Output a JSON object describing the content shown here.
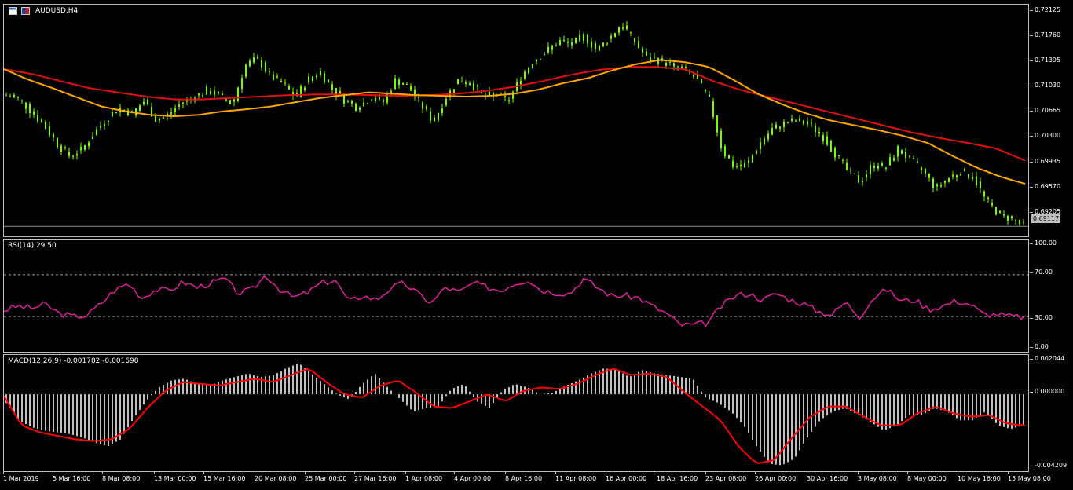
{
  "window": {
    "symbol_title": "AUDUSD,H4"
  },
  "price_axis": [
    "0.72125",
    "0.71760",
    "0.71395",
    "0.71030",
    "0.70665",
    "0.70300",
    "0.69935",
    "0.69570",
    "0.69205"
  ],
  "current_price": "0.69117",
  "rsi": {
    "label": "RSI(14) 29.50",
    "ticks": [
      "100.00",
      "70.00",
      "30.00",
      "0.00"
    ]
  },
  "macd": {
    "label": "MACD(12,26,9) -0.001782 -0.001698",
    "ticks": [
      "0.002044",
      "0.000000",
      "-0.004209"
    ]
  },
  "time_axis": [
    "1 Mar 2019",
    "5 Mar 16:00",
    "8 Mar 08:00",
    "13 Mar 00:00",
    "15 Mar 16:00",
    "20 Mar 08:00",
    "25 Mar 00:00",
    "27 Mar 16:00",
    "1 Apr 08:00",
    "4 Apr 00:00",
    "8 Apr 16:00",
    "11 Apr 08:00",
    "16 Apr 00:00",
    "18 Apr 16:00",
    "23 Apr 08:00",
    "26 Apr 00:00",
    "30 Apr 16:00",
    "3 May 08:00",
    "8 May 00:00",
    "10 May 16:00",
    "15 May 08:00"
  ],
  "colors": {
    "candles": "#7cfc00",
    "ma_fast": "#ffa500",
    "ma_slow": "#e01010",
    "rsi": "#e0209a",
    "macd_hist": "#c0c0c0",
    "macd_signal": "#ff0000"
  },
  "chart_data": [
    {
      "type": "line",
      "title": "AUDUSD,H4",
      "ylim": [
        0.6903,
        0.7222
      ],
      "x_range": [
        "1 Mar 2019",
        "15 May 08:00"
      ],
      "series": [
        {
          "name": "price",
          "style": "candles",
          "values": [
            0.7098,
            0.7092,
            0.7075,
            0.7055,
            0.703,
            0.7012,
            0.702,
            0.7045,
            0.7065,
            0.708,
            0.7072,
            0.709,
            0.706,
            0.7072,
            0.7088,
            0.7095,
            0.7105,
            0.7098,
            0.7085,
            0.714,
            0.715,
            0.7125,
            0.7115,
            0.7095,
            0.712,
            0.7132,
            0.7105,
            0.709,
            0.708,
            0.7095,
            0.7088,
            0.712,
            0.711,
            0.7085,
            0.706,
            0.7095,
            0.712,
            0.7115,
            0.7095,
            0.71,
            0.709,
            0.7125,
            0.7148,
            0.716,
            0.7175,
            0.717,
            0.7182,
            0.7162,
            0.7178,
            0.72,
            0.7175,
            0.715,
            0.7148,
            0.714,
            0.7135,
            0.712,
            0.709,
            0.702,
            0.6995,
            0.7,
            0.703,
            0.705,
            0.7058,
            0.7062,
            0.7055,
            0.704,
            0.7015,
            0.699,
            0.6975,
            0.7,
            0.6995,
            0.7022,
            0.7005,
            0.699,
            0.6965,
            0.698,
            0.699,
            0.6982,
            0.6948,
            0.693,
            0.6922,
            0.6912
          ]
        },
        {
          "name": "ma_fast",
          "values": [
            0.7135,
            0.712,
            0.7108,
            0.7095,
            0.7082,
            0.7075,
            0.707,
            0.7068,
            0.707,
            0.7075,
            0.7078,
            0.7082,
            0.7088,
            0.7094,
            0.7098,
            0.7102,
            0.71,
            0.7098,
            0.7097,
            0.7096,
            0.7097,
            0.71,
            0.7106,
            0.7115,
            0.7122,
            0.7133,
            0.7142,
            0.7148,
            0.7145,
            0.7138,
            0.712,
            0.71,
            0.7085,
            0.7072,
            0.7062,
            0.7055,
            0.7048,
            0.704,
            0.703,
            0.7012,
            0.6995,
            0.6982,
            0.6972
          ]
        },
        {
          "name": "ma_slow",
          "values": [
            0.7135,
            0.7128,
            0.7118,
            0.7108,
            0.7102,
            0.7096,
            0.7092,
            0.7092,
            0.7094,
            0.7096,
            0.7098,
            0.7099,
            0.7099,
            0.7098,
            0.7097,
            0.7098,
            0.71,
            0.7104,
            0.711,
            0.7118,
            0.7127,
            0.7134,
            0.7138,
            0.7138,
            0.7135,
            0.7118,
            0.7105,
            0.7095,
            0.7085,
            0.7075,
            0.7065,
            0.7055,
            0.7045,
            0.7037,
            0.703,
            0.7022,
            0.7005
          ]
        }
      ]
    },
    {
      "type": "line",
      "title": "RSI(14) 29.50",
      "ylim": [
        0,
        100
      ],
      "levels": [
        70,
        30
      ],
      "series": [
        {
          "name": "RSI",
          "values": [
            36,
            40,
            38,
            42,
            33,
            30,
            31,
            42,
            55,
            62,
            48,
            56,
            55,
            63,
            58,
            62,
            66,
            52,
            56,
            70,
            56,
            48,
            53,
            62,
            65,
            44,
            50,
            46,
            57,
            62,
            52,
            43,
            58,
            53,
            62,
            58,
            55,
            62,
            65,
            55,
            53,
            52,
            66,
            58,
            50,
            50,
            48,
            40,
            33,
            22,
            22,
            24,
            40,
            50,
            52,
            46,
            52,
            46,
            42,
            35,
            32,
            44,
            30,
            48,
            56,
            45,
            46,
            37,
            40,
            45,
            42,
            32,
            32,
            30,
            29.5
          ]
        }
      ]
    },
    {
      "type": "bar",
      "title": "MACD(12,26,9) -0.001782 -0.001698",
      "ylim": [
        -0.004209,
        0.002044
      ],
      "series": [
        {
          "name": "MACD",
          "values": [
            -0.0005,
            -0.0015,
            -0.0019,
            -0.0021,
            -0.0022,
            -0.0023,
            -0.0025,
            -0.0028,
            -0.003,
            -0.0026,
            -0.0014,
            -0.0004,
            0.0004,
            0.0008,
            0.0009,
            0.0006,
            0.0005,
            0.0008,
            0.001,
            0.0012,
            0.001,
            0.0011,
            0.0015,
            0.0018,
            0.0012,
            0.0006,
            0.0,
            -0.0003,
            0.0006,
            0.0012,
            0.0004,
            -0.0003,
            -0.001,
            -0.0008,
            -0.0007,
            0.0003,
            0.0006,
            -0.0004,
            -0.0008,
            0.0002,
            0.0006,
            0.0004,
            0.0,
            0.0001,
            0.0005,
            0.0008,
            0.0012,
            0.0015,
            0.0014,
            0.001,
            0.0014,
            0.0012,
            0.0011,
            0.001,
            0.0009,
            -0.0002,
            -0.0005,
            -0.001,
            -0.0018,
            -0.003,
            -0.004,
            -0.0041,
            -0.0037,
            -0.0025,
            -0.0015,
            -0.001,
            -0.0008,
            -0.0012,
            -0.0016,
            -0.0021,
            -0.0018,
            -0.0012,
            -0.0012,
            -0.0008,
            -0.001,
            -0.0015,
            -0.0015,
            -0.001,
            -0.0018,
            -0.002,
            -0.0018
          ]
        },
        {
          "name": "Signal",
          "values": [
            -0.0001,
            -0.0018,
            -0.0022,
            -0.0024,
            -0.0026,
            -0.0027,
            -0.0026,
            -0.002,
            -0.0008,
            0.0002,
            0.0007,
            0.0006,
            0.0005,
            0.0007,
            0.0009,
            0.0007,
            0.0011,
            0.0015,
            0.0007,
            0.0,
            -0.0002,
            0.0005,
            0.0008,
            0.0001,
            -0.0007,
            -0.0008,
            -0.0004,
            0.0,
            -0.0004,
            0.0002,
            0.0004,
            0.0003,
            0.0006,
            0.0011,
            0.0015,
            0.0011,
            0.0012,
            0.001,
            0.0001,
            -0.0007,
            -0.0015,
            -0.003,
            -0.004,
            -0.0038,
            -0.0025,
            -0.0013,
            -0.0007,
            -0.0007,
            -0.0013,
            -0.0018,
            -0.0018,
            -0.0011,
            -0.0007,
            -0.0011,
            -0.0013,
            -0.0012,
            -0.0017,
            -0.0018
          ]
        }
      ]
    }
  ]
}
